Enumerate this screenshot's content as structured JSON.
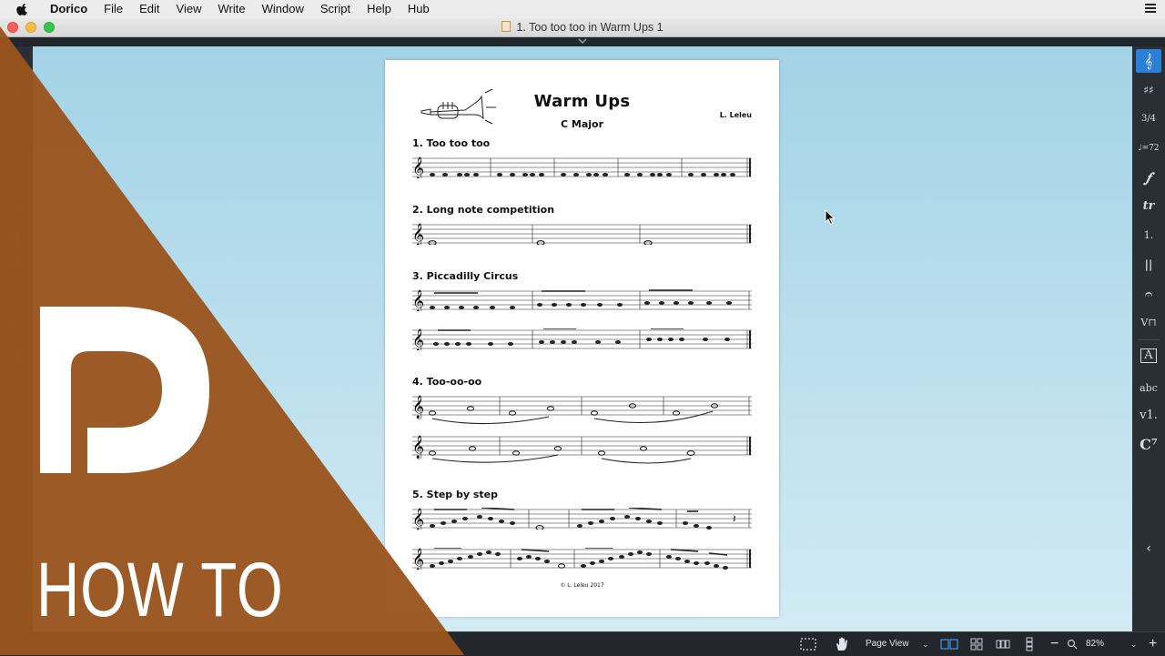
{
  "menubar": {
    "app_name": "Dorico",
    "items": [
      "File",
      "Edit",
      "View",
      "Write",
      "Window",
      "Script",
      "Help",
      "Hub"
    ]
  },
  "window": {
    "title": "1. Too too too in Warm Ups 1"
  },
  "left_toolbox": {
    "icons": [
      "note-icon",
      "rest-icon",
      "grace-note-icon",
      "tuplet-icon",
      "tie-icon",
      "slur-icon",
      "lock-icon",
      "clef-icon",
      "beam-icon",
      "scissors-icon",
      "select-arrow-icon"
    ]
  },
  "right_panel": {
    "tools": [
      {
        "icon": "clef-icon",
        "glyph": "𝄞",
        "active": true
      },
      {
        "icon": "key-signature-icon",
        "glyph": "♯♯",
        "active": false
      },
      {
        "icon": "time-signature-icon",
        "glyph": "3/4",
        "active": false
      },
      {
        "icon": "tempo-icon",
        "glyph": "♩=72",
        "active": false
      },
      {
        "icon": "dynamics-icon",
        "glyph": "𝆑",
        "active": false
      },
      {
        "icon": "ornaments-icon",
        "glyph": "tr",
        "active": false
      },
      {
        "icon": "repeat-ending-icon",
        "glyph": "1.",
        "active": false
      },
      {
        "icon": "barline-icon",
        "glyph": "||",
        "active": false
      },
      {
        "icon": "fermata-icon",
        "glyph": "𝄐",
        "active": false
      },
      {
        "icon": "bowing-icon",
        "glyph": "V⊓",
        "active": false
      },
      {
        "icon": "text-icon",
        "glyph": "A",
        "active": false
      },
      {
        "icon": "lyrics-icon",
        "glyph": "abc",
        "active": false
      },
      {
        "icon": "figured-bass-icon",
        "glyph": "v1.",
        "active": false
      },
      {
        "icon": "chord-symbol-icon",
        "glyph": "C⁷",
        "active": false
      }
    ]
  },
  "score": {
    "title": "Warm Ups",
    "subtitle": "C Major",
    "composer": "L. Leleu",
    "copyright": "© L. Leleu 2017",
    "sections": [
      {
        "label": "1. Too too too"
      },
      {
        "label": "2. Long note competition"
      },
      {
        "label": "3. Piccadilly Circus"
      },
      {
        "label": "4. Too-oo-oo"
      },
      {
        "label": "5. Step by step"
      }
    ]
  },
  "statusbar": {
    "view_mode": "Page View",
    "zoom": "82%"
  },
  "overlay": {
    "caption": "HOW TO",
    "brand_color": "#9a541d"
  }
}
